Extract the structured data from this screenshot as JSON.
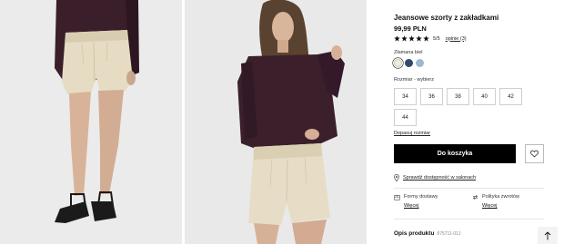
{
  "images": [
    {
      "alt": "Model wearing cream pleated denim shorts, legs view with black sandals"
    },
    {
      "alt": "Model wearing cream pleated denim shorts with burgundy shirt"
    }
  ],
  "product": {
    "title": "Jeansowe szorty z zakładkami",
    "price": "99,99 PLN",
    "rating": {
      "stars": 5,
      "score_text": "5/5",
      "reviews_text": "opinie (3)"
    },
    "color": {
      "label": "Złamana biel",
      "swatches": [
        {
          "name": "Złamana biel",
          "hex": "#efebe0",
          "selected": true
        },
        {
          "name": "Granatowy",
          "hex": "#2f4a6a",
          "selected": false
        },
        {
          "name": "Jasnoniebieski",
          "hex": "#9fb6cf",
          "selected": false
        }
      ]
    },
    "size": {
      "label": "Rozmiar - wybierz",
      "options": [
        "34",
        "36",
        "38",
        "40",
        "42",
        "44"
      ],
      "fit_link": "Dopasuj rozmiar"
    },
    "cart_button": "Do koszyka",
    "store_link": "Sprawdź dostępność w salonach",
    "shipping": {
      "title": "Formy dostawy",
      "link": "Więcej"
    },
    "returns": {
      "title": "Polityka zwrotów",
      "link": "Więcej"
    },
    "description": {
      "title": "Opis produktu",
      "ref": "875711-01J"
    }
  },
  "icons": {
    "star": "star-icon",
    "wishlist": "heart-icon",
    "store": "map-pin-icon",
    "shipping": "box-icon",
    "returns": "exchange-icon",
    "scroll_top": "arrow-up-icon"
  },
  "colors": {
    "accent": "#000000",
    "star": "#111111"
  }
}
